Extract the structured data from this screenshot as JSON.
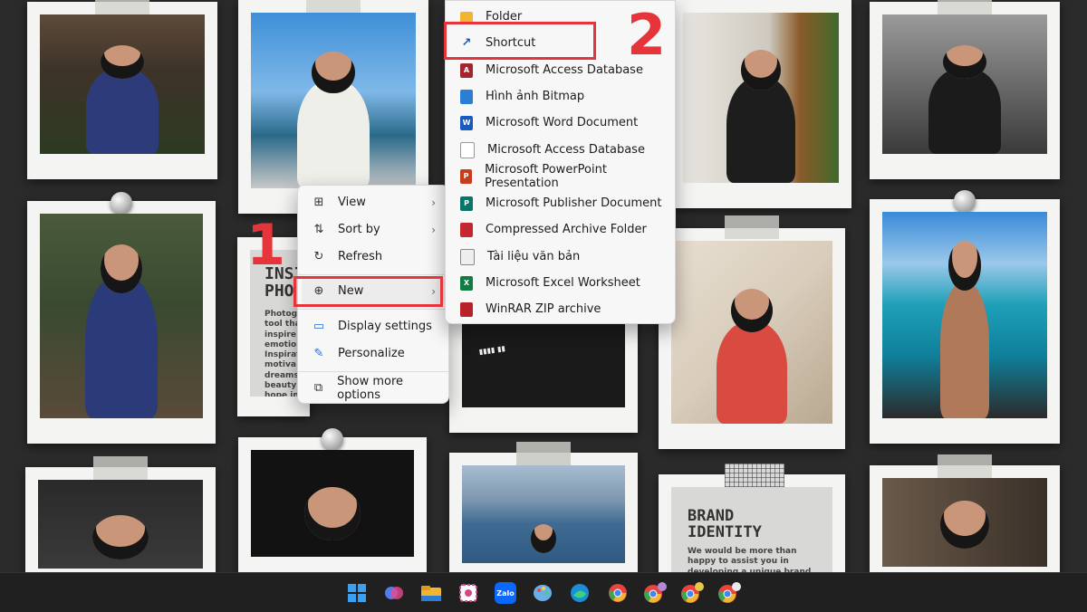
{
  "context_menu": {
    "items": [
      {
        "label": "View",
        "icon": "grid-icon",
        "has_submenu": true
      },
      {
        "label": "Sort by",
        "icon": "sort-icon",
        "has_submenu": true
      },
      {
        "label": "Refresh",
        "icon": "refresh-icon",
        "has_submenu": false
      },
      {
        "label": "New",
        "icon": "plus-circle-icon",
        "has_submenu": true
      },
      {
        "label": "Display settings",
        "icon": "display-icon",
        "has_submenu": false
      },
      {
        "label": "Personalize",
        "icon": "brush-icon",
        "has_submenu": false
      },
      {
        "label": "Show more options",
        "icon": "external-icon",
        "has_submenu": false
      }
    ]
  },
  "new_submenu": {
    "items": [
      {
        "label": "Folder",
        "icon": "folder-icon",
        "color": "#f2b531"
      },
      {
        "label": "Shortcut",
        "icon": "shortcut-arrow-icon",
        "color": "#1c5aa6"
      },
      {
        "label": "Microsoft Access Database",
        "icon": "access-icon",
        "color": "#a4262c"
      },
      {
        "label": "Hình ảnh Bitmap",
        "icon": "bitmap-icon",
        "color": "#2a7fd4"
      },
      {
        "label": "Microsoft Word Document",
        "icon": "word-icon",
        "color": "#185abd"
      },
      {
        "label": "Microsoft Access Database",
        "icon": "blank-file-icon",
        "color": "#9a9a9a"
      },
      {
        "label": "Microsoft PowerPoint Presentation",
        "icon": "powerpoint-icon",
        "color": "#c43e1c"
      },
      {
        "label": "Microsoft Publisher Document",
        "icon": "publisher-icon",
        "color": "#077568"
      },
      {
        "label": "Compressed Archive Folder",
        "icon": "archive-icon",
        "color": "#c4262e"
      },
      {
        "label": "Tài liệu văn bản",
        "icon": "text-file-icon",
        "color": "#8a8a8a"
      },
      {
        "label": "Microsoft Excel Worksheet",
        "icon": "excel-icon",
        "color": "#107c41"
      },
      {
        "label": "WinRAR ZIP archive",
        "icon": "winrar-icon",
        "color": "#b8202a"
      }
    ]
  },
  "annotations": {
    "step1": "1",
    "step2": "2"
  },
  "posters": {
    "left": {
      "title_line1": "INSI",
      "title_line2": "PHO",
      "body": "Photog tool tha inspire emotio Inspirat motiva dreams beauty hope in"
    },
    "right": {
      "title_line1": "BRAND",
      "title_line2": "IDENTITY",
      "body": "We would be more than happy to assist you in developing a unique brand identity that"
    }
  },
  "taskbar": {
    "icons": [
      "windows-start-icon",
      "copilot-icon",
      "file-explorer-icon",
      "snipping-tool-icon",
      "zalo-icon",
      "paint-icon",
      "edge-icon",
      "chrome-icon",
      "chrome-profile-1-icon",
      "chrome-profile-2-icon",
      "chrome-profile-3-icon"
    ],
    "zalo_label": "Zalo"
  },
  "colors": {
    "accent_red": "#e5343a",
    "menu_bg": "#f7f7f7",
    "desktop_bg": "#2b2b2b"
  }
}
